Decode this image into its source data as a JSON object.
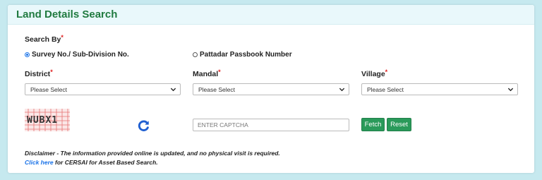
{
  "header": {
    "title": "Land Details Search"
  },
  "search_by": {
    "label": "Search By",
    "required_mark": "*",
    "options": [
      {
        "label": "Survey No./ Sub-Division No.",
        "selected": true
      },
      {
        "label": "Pattadar Passbook Number",
        "selected": false
      }
    ]
  },
  "fields": {
    "district": {
      "label": "District",
      "required_mark": "*",
      "value": "Please Select"
    },
    "mandal": {
      "label": "Mandal",
      "required_mark": "*",
      "value": "Please Select"
    },
    "village": {
      "label": "Village",
      "required_mark": "*",
      "value": "Please Select"
    }
  },
  "captcha": {
    "text": "WUBX1",
    "input_placeholder": "ENTER CAPTCHA",
    "refresh_icon": "refresh-icon"
  },
  "buttons": {
    "fetch": "Fetch",
    "reset": "Reset"
  },
  "footer": {
    "disclaimer": "Disclaimer - The information provided online is updated, and no physical visit is required.",
    "link_text": "Click here",
    "link_suffix": " for CERSAI for Asset Based Search."
  },
  "colors": {
    "page_bg": "#c6e9ef",
    "title_green": "#1f7a3f",
    "button_green": "#2a9a5a",
    "required_red": "#e01f1f",
    "link_blue": "#1a73e8"
  }
}
